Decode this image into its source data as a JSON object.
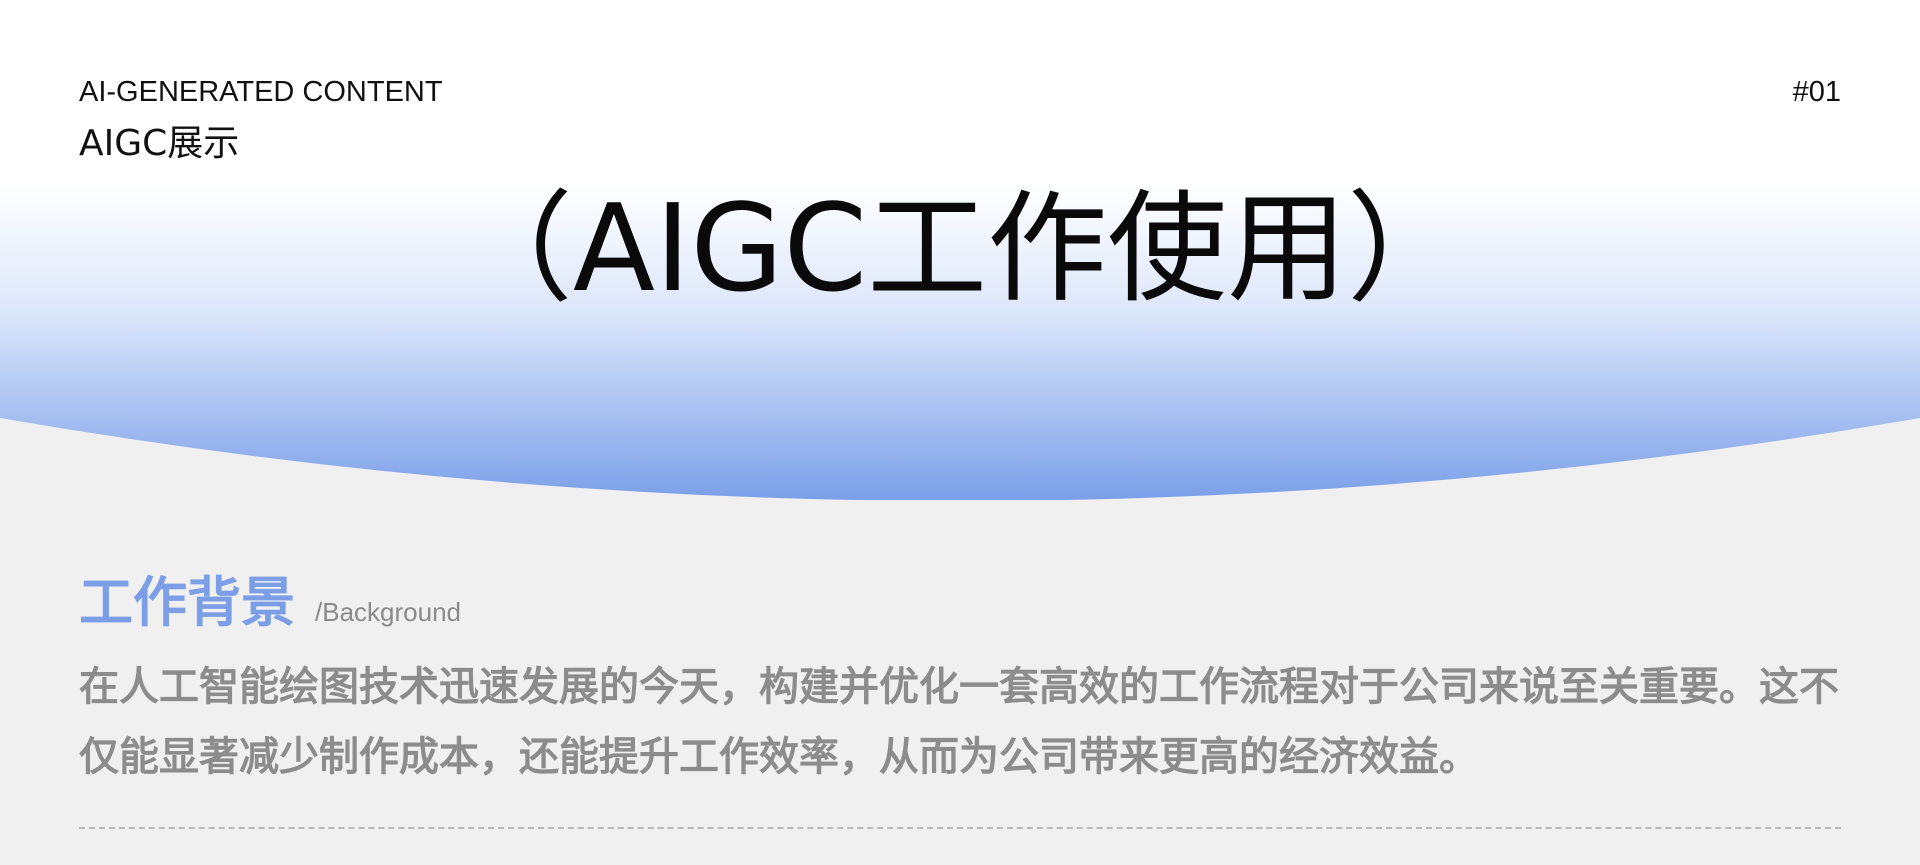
{
  "header": {
    "eyebrow": "AI-GENERATED CONTENT",
    "subtitle": "AIGC展示",
    "page_number": "#01"
  },
  "hero": {
    "title": "（AIGC工作使用）",
    "gradient_top": "#ffffff",
    "gradient_bottom": "#7a9fe8"
  },
  "section": {
    "title": "工作背景",
    "subtitle": "/Background",
    "body": "在人工智能绘图技术迅速发展的今天，构建并优化一套高效的工作流程对于公司来说至关重要。这不仅能显著减少制作成本，还能提升工作效率，从而为公司带来更高的经济效益。",
    "accent_color": "#7c9ee6"
  }
}
